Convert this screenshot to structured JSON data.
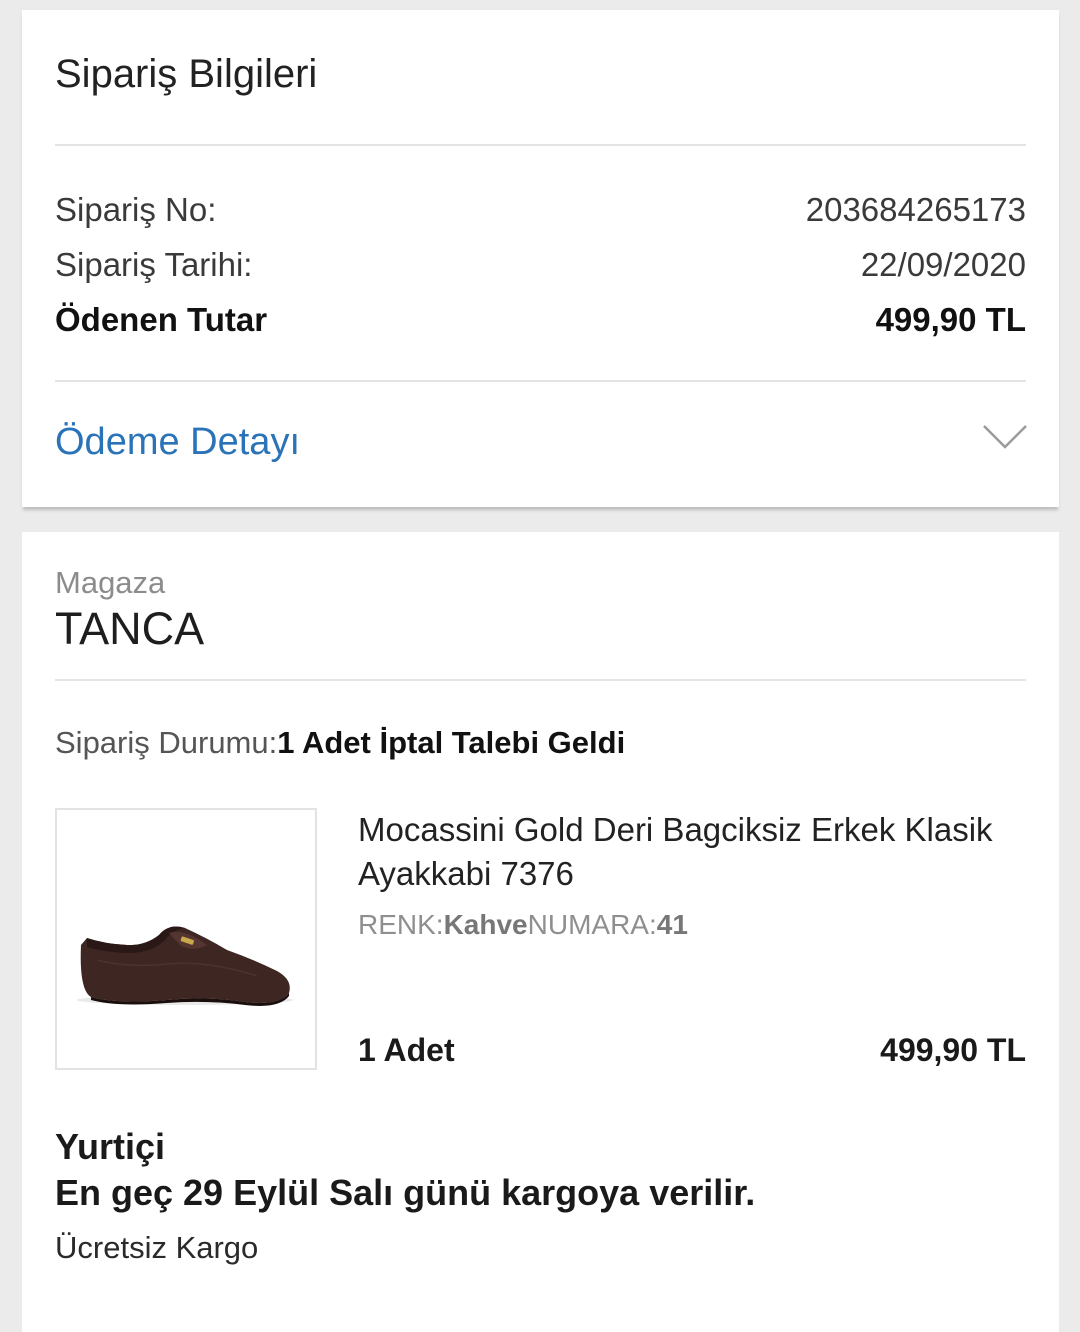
{
  "order_info": {
    "title": "Sipariş Bilgileri",
    "rows": [
      {
        "label": "Sipariş No:",
        "value": "203684265173"
      },
      {
        "label": "Sipariş Tarihi:",
        "value": "22/09/2020"
      },
      {
        "label": "Ödenen Tutar",
        "value": "499,90 TL"
      }
    ],
    "payment_detail_link": "Ödeme Detayı",
    "payment_detail_icon": "chevron-down-icon"
  },
  "store": {
    "label": "Magaza",
    "name": "TANCA",
    "status_label": "Sipariş Durumu:",
    "status_value": "1 Adet İptal Talebi Geldi"
  },
  "product": {
    "image": "brown-loafer-shoe-image",
    "name": "Mocassini Gold Deri Bagciksiz Erkek Klasik Ayakkabi 7376",
    "color_label": "RENK:",
    "color_value": "Kahve",
    "size_label": "NUMARA:",
    "size_value": "41",
    "quantity": "1 Adet",
    "price": "499,90 TL"
  },
  "shipping": {
    "carrier": "Yurtiçi",
    "eta": "En geç 29 Eylül Salı günü kargoya verilir.",
    "cost": "Ücretsiz Kargo"
  }
}
